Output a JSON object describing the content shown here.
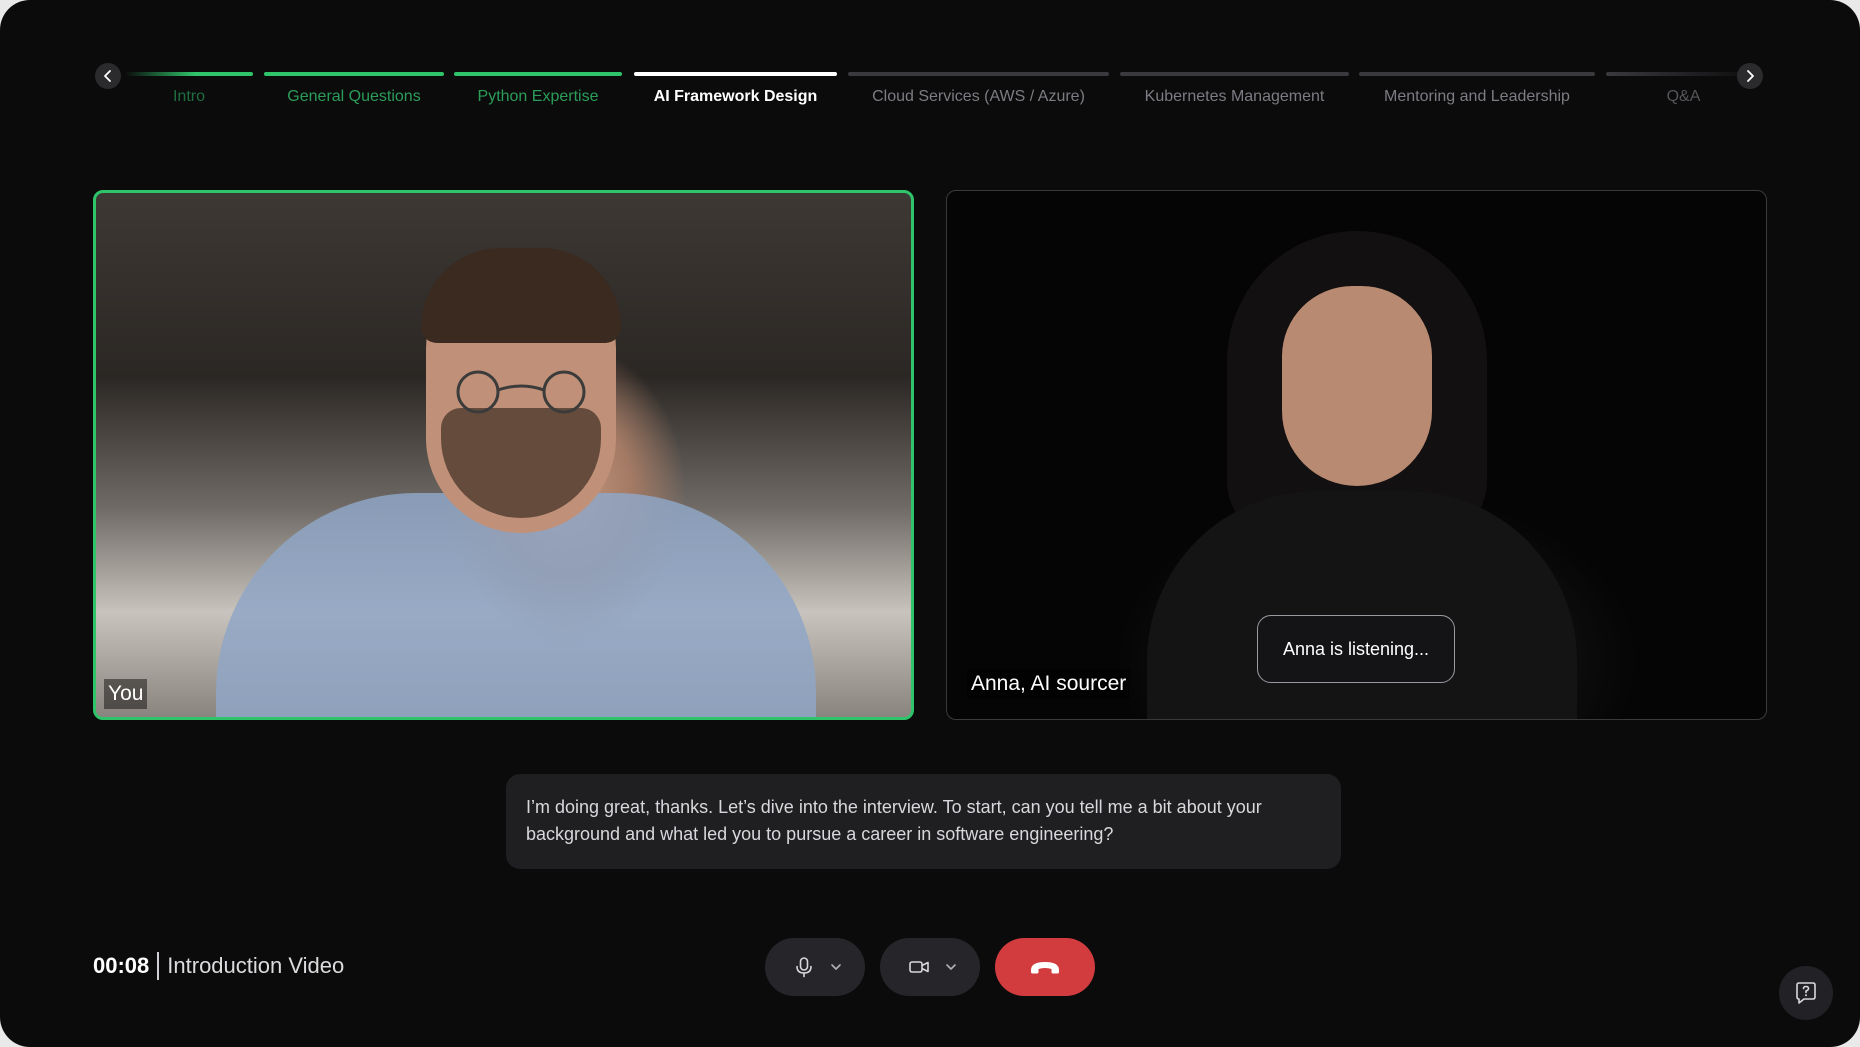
{
  "stepper": {
    "steps": [
      {
        "label": "Intro",
        "state": "done"
      },
      {
        "label": "General Questions",
        "state": "done"
      },
      {
        "label": "Python Expertise",
        "state": "done"
      },
      {
        "label": "AI Framework Design",
        "state": "current"
      },
      {
        "label": "Cloud Services (AWS / Azure)",
        "state": "upcoming"
      },
      {
        "label": "Kubernetes Management",
        "state": "upcoming"
      },
      {
        "label": "Mentoring and Leadership",
        "state": "upcoming"
      },
      {
        "label": "Q&A",
        "state": "upcoming"
      }
    ],
    "prev_icon": "chevron-left-icon",
    "next_icon": "chevron-right-icon"
  },
  "video": {
    "self": {
      "name": "You",
      "active_speaker": true
    },
    "interviewer": {
      "name": "Anna, AI sourcer",
      "status": "Anna is listening..."
    }
  },
  "transcript": {
    "text": "I’m doing great, thanks. Let’s dive into the interview. To start, can you tell me a bit about your background and what led you to pursue a career in software engineering?"
  },
  "footer": {
    "elapsed": "00:08",
    "session_title": "Introduction Video"
  },
  "controls": {
    "mic_icon": "microphone-icon",
    "camera_icon": "video-camera-icon",
    "end_call_icon": "hang-up-icon",
    "help_icon": "help-chat-icon"
  },
  "colors": {
    "background": "#0b0b0c",
    "accent_green": "#2fc46a",
    "end_call_red": "#d23c3e",
    "panel": "#1f1f22"
  }
}
